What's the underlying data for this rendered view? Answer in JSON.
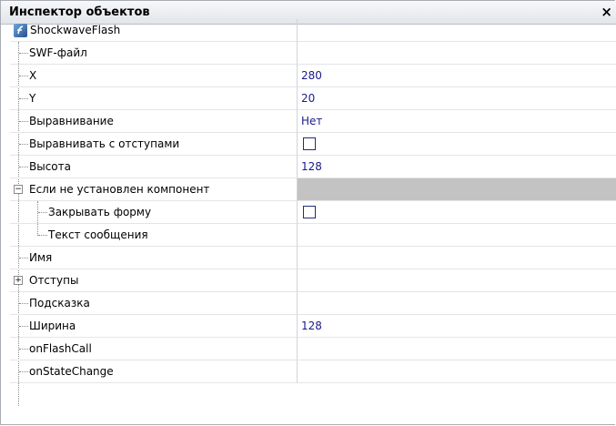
{
  "panel": {
    "title": "Инспектор объектов",
    "close_glyph": "×"
  },
  "component": {
    "name": "ShockwaveFlash",
    "icon": "flash-icon"
  },
  "rows": [
    {
      "label": "SWF-файл",
      "value": ""
    },
    {
      "label": "X",
      "value": "280"
    },
    {
      "label": "Y",
      "value": "20"
    },
    {
      "label": "Выравнивание",
      "value": "Нет"
    },
    {
      "label": "Выравнивать с отступами",
      "value": "",
      "checkbox": false
    },
    {
      "label": "Высота",
      "value": "128"
    },
    {
      "label": "Если не установлен компонент",
      "value": "",
      "expanded": true
    },
    {
      "label": "Закрывать форму",
      "value": "",
      "checkbox": false
    },
    {
      "label": "Текст сообщения",
      "value": ""
    },
    {
      "label": "Имя",
      "value": ""
    },
    {
      "label": "Отступы",
      "value": "",
      "expanded": false
    },
    {
      "label": "Подсказка",
      "value": ""
    },
    {
      "label": "Ширина",
      "value": "128"
    },
    {
      "label": "onFlashCall",
      "value": ""
    },
    {
      "label": "onStateChange",
      "value": ""
    }
  ],
  "colors": {
    "value_text": "#1a1a8c",
    "shaded_value": "#c3c3c3"
  }
}
